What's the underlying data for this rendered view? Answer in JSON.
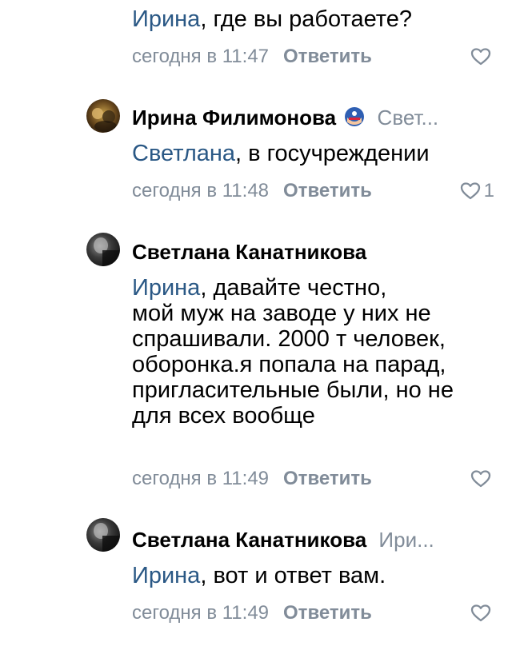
{
  "comments": [
    {
      "mention": "Ирина",
      "text": ", где вы работаете?",
      "time": "сегодня в 11:47",
      "reply_label": "Ответить",
      "likes": ""
    },
    {
      "author": "Ирина Филимонова",
      "reply_to": "Свет...",
      "mention": "Светлана",
      "text": ", в госучреждении",
      "time": "сегодня в 11:48",
      "reply_label": "Ответить",
      "likes": "1"
    },
    {
      "author": "Светлана Канатникова",
      "mention": "Ирина",
      "text": ", давайте честно,\nмой муж на заводе у них не спрашивали. 2000 т человек, оборонка.я попала на парад, пригласительные были, но не для всех вообще",
      "time": "сегодня в 11:49",
      "reply_label": "Ответить",
      "likes": ""
    },
    {
      "author": "Светлана Канатникова",
      "reply_to": "Ири...",
      "mention": "Ирина",
      "text": ", вот и ответ вам.",
      "time": "сегодня в 11:49",
      "reply_label": "Ответить",
      "likes": ""
    }
  ],
  "icons": {
    "like": "heart-outline-icon",
    "badge": "captain-america-badge-icon"
  },
  "colors": {
    "mention": "#2a5885",
    "secondary_text": "#818c99",
    "primary_text": "#000000"
  }
}
